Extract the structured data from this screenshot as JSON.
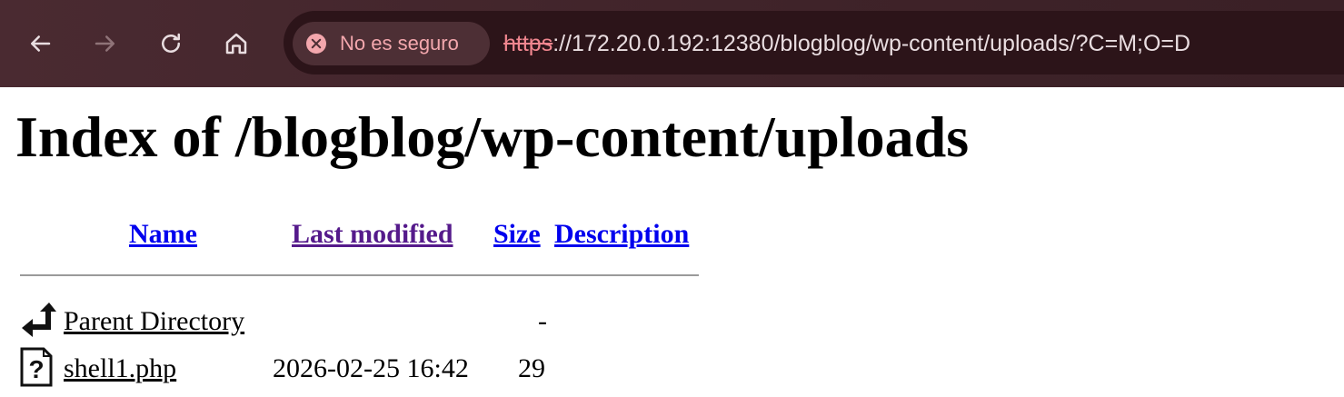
{
  "browser": {
    "security_label": "No es seguro",
    "url_scheme": "https",
    "url_rest": "://172.20.0.192:12380/blogblog/wp-content/uploads/?C=M;O=D",
    "buttons": [
      "back",
      "forward",
      "reload",
      "home"
    ],
    "icons": [
      "arrow-left-icon",
      "arrow-right-icon",
      "reload-icon",
      "home-icon",
      "not-secure-icon"
    ],
    "colors": {
      "toolbar": "#4a2a31",
      "warning": "#f3a7ad"
    }
  },
  "page": {
    "title": "Index of /blogblog/wp-content/uploads",
    "columns": {
      "name": "Name",
      "last_modified": "Last modified",
      "size": "Size",
      "description": "Description"
    },
    "rows": [
      {
        "icon": "back-arrow-icon",
        "name": "Parent Directory",
        "modified": "",
        "size": "-",
        "description": ""
      },
      {
        "icon": "unknown-file-icon",
        "name": "shell1.php",
        "modified": "2026-02-25 16:42",
        "size": "29",
        "description": ""
      }
    ]
  }
}
